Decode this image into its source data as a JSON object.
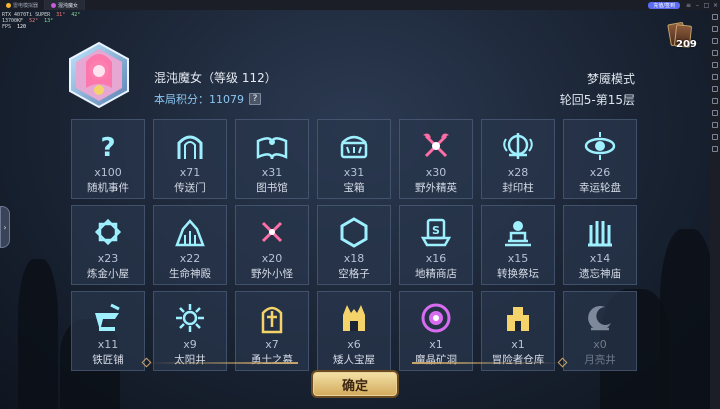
{
  "emulator": {
    "tabs": [
      {
        "label": "雷电模拟器",
        "active": false
      },
      {
        "label": "混沌魔女",
        "active": true
      }
    ],
    "recharge_label": "充值/签到"
  },
  "perf": {
    "gpu": "RTX 4070Ti SUPER",
    "gpu_temp": "31°",
    "gpu_load": "42°",
    "cpu": "13700KF",
    "cpu_temp": "52°",
    "cpu_load": "13°",
    "fps_label": "FPS",
    "fps_value": "120"
  },
  "card_counter": "209",
  "header": {
    "boss_name": "混沌魔女（等级 112）",
    "score_label": "本局积分：",
    "score_value": "11079",
    "help": "?",
    "mode": "梦魇模式",
    "round": "轮回5-第15层"
  },
  "events": [
    {
      "icon": "question-icon",
      "count": "x100",
      "name": "随机事件"
    },
    {
      "icon": "portal-icon",
      "count": "x71",
      "name": "传送门"
    },
    {
      "icon": "library-icon",
      "count": "x31",
      "name": "图书馆"
    },
    {
      "icon": "chest-icon",
      "count": "x31",
      "name": "宝箱"
    },
    {
      "icon": "elite-axe-icon",
      "count": "x30",
      "name": "野外精英"
    },
    {
      "icon": "seal-pillar-icon",
      "count": "x28",
      "name": "封印柱"
    },
    {
      "icon": "lucky-wheel-icon",
      "count": "x26",
      "name": "幸运轮盘"
    },
    {
      "icon": "alchemy-hut-icon",
      "count": "x23",
      "name": "炼金小屋"
    },
    {
      "icon": "life-temple-icon",
      "count": "x22",
      "name": "生命神殿"
    },
    {
      "icon": "monster-swords-icon",
      "count": "x20",
      "name": "野外小怪"
    },
    {
      "icon": "hexagon-icon",
      "count": "x18",
      "name": "空格子"
    },
    {
      "icon": "shop-hat-icon",
      "count": "x16",
      "name": "地精商店"
    },
    {
      "icon": "altar-icon",
      "count": "x15",
      "name": "转换祭坛"
    },
    {
      "icon": "forgotten-temple-icon",
      "count": "x14",
      "name": "遗忘神庙"
    },
    {
      "icon": "anvil-icon",
      "count": "x11",
      "name": "铁匠铺"
    },
    {
      "icon": "sun-well-icon",
      "count": "x9",
      "name": "太阳井"
    },
    {
      "icon": "tomb-icon",
      "count": "x7",
      "name": "勇士之墓"
    },
    {
      "icon": "dwarf-treasure-icon",
      "count": "x6",
      "name": "矮人宝屋"
    },
    {
      "icon": "crystal-cave-icon",
      "count": "x1",
      "name": "魔晶矿洞"
    },
    {
      "icon": "treasury-icon",
      "count": "x1",
      "name": "冒险者仓库"
    },
    {
      "icon": "moon-well-icon",
      "count": "x0",
      "name": "月亮井",
      "dim": true
    }
  ],
  "confirm_label": "确定",
  "colors": {
    "cyan": "#9ef0ff",
    "pink": "#ff6fa6",
    "yellow": "#f4d36a",
    "gold": "#c9a56a",
    "purple": "#d86cf0"
  }
}
